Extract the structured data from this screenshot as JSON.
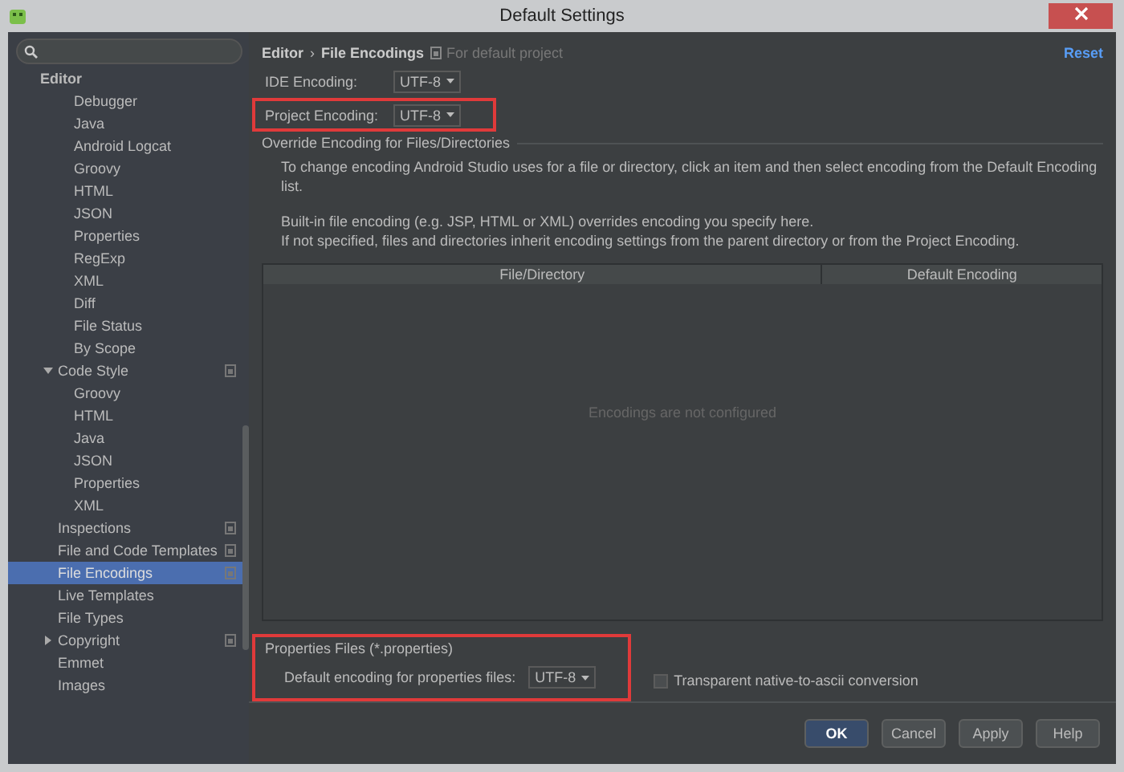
{
  "window": {
    "title": "Default Settings"
  },
  "sidebar": {
    "tree": [
      {
        "label": "Editor",
        "kind": "header",
        "children": [
          {
            "label": "Debugger",
            "kind": "subitem",
            "selected": false,
            "project_icon": false
          },
          {
            "label": "Java",
            "kind": "subitem",
            "selected": false,
            "project_icon": false
          },
          {
            "label": "Android Logcat",
            "kind": "subitem",
            "selected": false,
            "project_icon": false
          },
          {
            "label": "Groovy",
            "kind": "subitem",
            "selected": false,
            "project_icon": false
          },
          {
            "label": "HTML",
            "kind": "subitem",
            "selected": false,
            "project_icon": false
          },
          {
            "label": "JSON",
            "kind": "subitem",
            "selected": false,
            "project_icon": false
          },
          {
            "label": "Properties",
            "kind": "subitem",
            "selected": false,
            "project_icon": false
          },
          {
            "label": "RegExp",
            "kind": "subitem",
            "selected": false,
            "project_icon": false
          },
          {
            "label": "XML",
            "kind": "subitem",
            "selected": false,
            "project_icon": false
          },
          {
            "label": "Diff",
            "kind": "subitem",
            "selected": false,
            "project_icon": false
          },
          {
            "label": "File Status",
            "kind": "subitem",
            "selected": false,
            "project_icon": false
          },
          {
            "label": "By Scope",
            "kind": "subitem",
            "selected": false,
            "project_icon": false
          },
          {
            "label": "Code Style",
            "kind": "node",
            "expanded": true,
            "selected": false,
            "project_icon": true,
            "children": [
              {
                "label": "Groovy",
                "kind": "item",
                "selected": false,
                "project_icon": false
              },
              {
                "label": "HTML",
                "kind": "item",
                "selected": false,
                "project_icon": false
              },
              {
                "label": "Java",
                "kind": "item",
                "selected": false,
                "project_icon": false
              },
              {
                "label": "JSON",
                "kind": "item",
                "selected": false,
                "project_icon": false
              },
              {
                "label": "Properties",
                "kind": "item",
                "selected": false,
                "project_icon": false
              },
              {
                "label": "XML",
                "kind": "item",
                "selected": false,
                "project_icon": false
              }
            ]
          },
          {
            "label": "Inspections",
            "kind": "item",
            "selected": false,
            "project_icon": true
          },
          {
            "label": "File and Code Templates",
            "kind": "item",
            "selected": false,
            "project_icon": true
          },
          {
            "label": "File Encodings",
            "kind": "item",
            "selected": true,
            "project_icon": true
          },
          {
            "label": "Live Templates",
            "kind": "item",
            "selected": false,
            "project_icon": false
          },
          {
            "label": "File Types",
            "kind": "item",
            "selected": false,
            "project_icon": false
          },
          {
            "label": "Copyright",
            "kind": "node",
            "expanded": false,
            "selected": false,
            "project_icon": true
          },
          {
            "label": "Emmet",
            "kind": "item",
            "selected": false,
            "project_icon": false
          },
          {
            "label": "Images",
            "kind": "item",
            "selected": false,
            "project_icon": false
          }
        ]
      }
    ]
  },
  "breadcrumb": {
    "parent": "Editor",
    "separator": "›",
    "current": "File Encodings",
    "scope": "For default project"
  },
  "reset": "Reset",
  "encodings": [
    {
      "label": "IDE Encoding:",
      "value": "UTF-8",
      "highlighted": false
    },
    {
      "label": "Project Encoding:",
      "value": "UTF-8",
      "highlighted": true
    }
  ],
  "override": {
    "title": "Override Encoding for Files/Directories",
    "paragraphs": [
      "To change encoding Android Studio uses for a file or directory, click an item and then select encoding from the Default Encoding list.",
      "Built-in file encoding (e.g. JSP, HTML or XML) overrides encoding you specify here.\nIf not specified, files and directories inherit encoding settings from the parent directory or from the Project Encoding."
    ],
    "table": {
      "columns": [
        "File/Directory",
        "Default Encoding"
      ],
      "empty_text": "Encodings are not configured"
    }
  },
  "properties": {
    "title": "Properties Files (*.properties)",
    "label": "Default encoding for properties files:",
    "value": "UTF-8",
    "highlighted": true,
    "checkbox": {
      "label": "Transparent native-to-ascii conversion",
      "checked": false
    }
  },
  "buttons": [
    {
      "label": "OK",
      "default": true
    },
    {
      "label": "Cancel",
      "default": false
    },
    {
      "label": "Apply",
      "default": false
    },
    {
      "label": "Help",
      "default": false
    }
  ]
}
